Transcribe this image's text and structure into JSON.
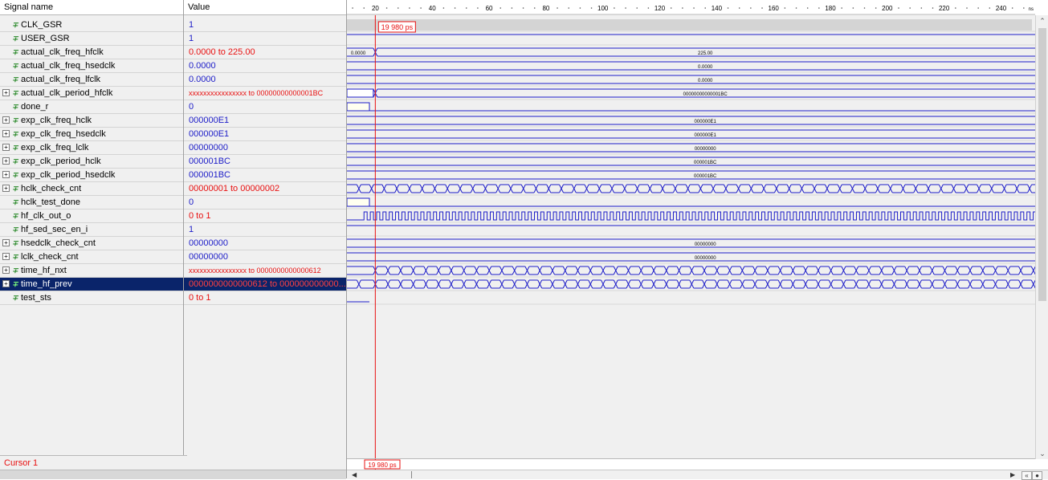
{
  "columns": {
    "name": "Signal name",
    "value": "Value"
  },
  "signals": [
    {
      "name": "CLK_GSR",
      "value": "1",
      "expandable": false,
      "value_color": "blue"
    },
    {
      "name": "USER_GSR",
      "value": "1",
      "expandable": false,
      "value_color": "blue"
    },
    {
      "name": "actual_clk_freq_hfclk",
      "value": "0.0000 to 225.00",
      "expandable": false,
      "value_color": "red"
    },
    {
      "name": "actual_clk_freq_hsedclk",
      "value": "0.0000",
      "expandable": false,
      "value_color": "blue"
    },
    {
      "name": "actual_clk_freq_lfclk",
      "value": "0.0000",
      "expandable": false,
      "value_color": "blue"
    },
    {
      "name": "actual_clk_period_hfclk",
      "value": "xxxxxxxxxxxxxxxx to 00000000000001BC",
      "expandable": true,
      "value_color": "red"
    },
    {
      "name": "done_r",
      "value": "0",
      "expandable": false,
      "value_color": "blue"
    },
    {
      "name": "exp_clk_freq_hclk",
      "value": "000000E1",
      "expandable": true,
      "value_color": "blue"
    },
    {
      "name": "exp_clk_freq_hsedclk",
      "value": "000000E1",
      "expandable": true,
      "value_color": "blue"
    },
    {
      "name": "exp_clk_freq_lclk",
      "value": "00000000",
      "expandable": true,
      "value_color": "blue"
    },
    {
      "name": "exp_clk_period_hclk",
      "value": "000001BC",
      "expandable": true,
      "value_color": "blue"
    },
    {
      "name": "exp_clk_period_hsedclk",
      "value": "000001BC",
      "expandable": true,
      "value_color": "blue"
    },
    {
      "name": "hclk_check_cnt",
      "value": "00000001 to 00000002",
      "expandable": true,
      "value_color": "red"
    },
    {
      "name": "hclk_test_done",
      "value": "0",
      "expandable": false,
      "value_color": "blue"
    },
    {
      "name": "hf_clk_out_o",
      "value": "0 to 1",
      "expandable": false,
      "value_color": "red"
    },
    {
      "name": "hf_sed_sec_en_i",
      "value": "1",
      "expandable": false,
      "value_color": "blue"
    },
    {
      "name": "hsedclk_check_cnt",
      "value": "00000000",
      "expandable": true,
      "value_color": "blue"
    },
    {
      "name": "lclk_check_cnt",
      "value": "00000000",
      "expandable": true,
      "value_color": "blue"
    },
    {
      "name": "time_hf_nxt",
      "value": "xxxxxxxxxxxxxxxx to 0000000000000612",
      "expandable": true,
      "value_color": "red"
    },
    {
      "name": "time_hf_prev",
      "value": "0000000000000612 to 000000000000...",
      "expandable": true,
      "value_color": "red",
      "selected": true
    },
    {
      "name": "test_sts",
      "value": "0 to 1",
      "expandable": false,
      "value_color": "red"
    }
  ],
  "footer": {
    "cursor_label": "Cursor 1"
  },
  "cursor": {
    "time_label": "19 980 ps",
    "time_value": 19.98
  },
  "timeline": {
    "ticks": [
      "20",
      "40",
      "60",
      "80",
      "100",
      "120",
      "140",
      "160",
      "180",
      "200",
      "220",
      "240"
    ],
    "tick_values": [
      20,
      40,
      60,
      80,
      100,
      120,
      140,
      160,
      180,
      200,
      220,
      240
    ],
    "unit": "ns",
    "range": [
      10,
      252
    ]
  },
  "wave_labels": {
    "actual_clk_freq_hfclk_before": "0.0000",
    "actual_clk_freq_hfclk_after": "225.00",
    "actual_clk_freq_hsedclk": "0.0000",
    "actual_clk_freq_lfclk": "0.0000",
    "actual_clk_period_hfclk": "00000000000001BC",
    "exp_clk_freq_hclk": "000000E1",
    "exp_clk_freq_hsedclk": "000000E1",
    "exp_clk_freq_lclk": "00000000",
    "exp_clk_period_hclk": "000001BC",
    "exp_clk_period_hsedclk": "000001BC",
    "hsedclk_check_cnt": "00000000",
    "lclk_check_cnt": "00000000"
  },
  "colors": {
    "wave": "#1c1cc8",
    "cursor": "#e81010",
    "selected": "#0a246a"
  }
}
